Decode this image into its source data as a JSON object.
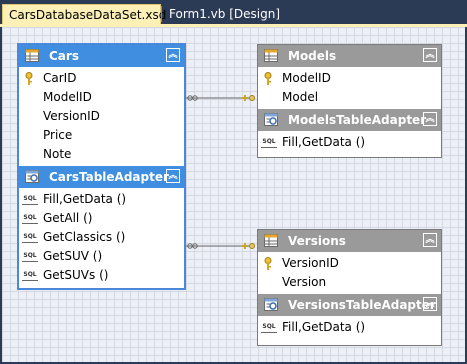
{
  "tabs": [
    {
      "label": "CarsDatabaseDataSet.xsd",
      "active": true
    },
    {
      "label": "Form1.vb [Design]",
      "active": false
    }
  ],
  "colors": {
    "tab_strip": "#2b3a55",
    "active_tab": "#fdf0b7",
    "table_header_blue": "#3f8ee0",
    "table_header_gray": "#9a9a9a",
    "canvas": "#eceff5"
  },
  "icons": {
    "table": "datatable-icon",
    "key": "primary-key-icon",
    "sql": "sql-query-icon",
    "adapter": "tableadapter-icon",
    "collapse": "collapse-chevron-icon"
  },
  "cars": {
    "title": "Cars",
    "columns": [
      "CarID",
      "ModelID",
      "VersionID",
      "Price",
      "Note"
    ],
    "adapter": {
      "title": "CarsTableAdapter",
      "methods": [
        "Fill,GetData ()",
        "GetAll ()",
        "GetClassics ()",
        "GetSUV ()",
        "GetSUVs ()"
      ]
    }
  },
  "models": {
    "title": "Models",
    "columns": [
      "ModelID",
      "Model"
    ],
    "adapter": {
      "title": "ModelsTableAdapter",
      "methods": [
        "Fill,GetData ()"
      ]
    }
  },
  "versions": {
    "title": "Versions",
    "columns": [
      "VersionID",
      "Version"
    ],
    "adapter": {
      "title": "VersionsTableAdapter",
      "methods": [
        "Fill,GetData ()"
      ]
    }
  },
  "sql_label": "SQL",
  "collapse_glyph": "︽"
}
